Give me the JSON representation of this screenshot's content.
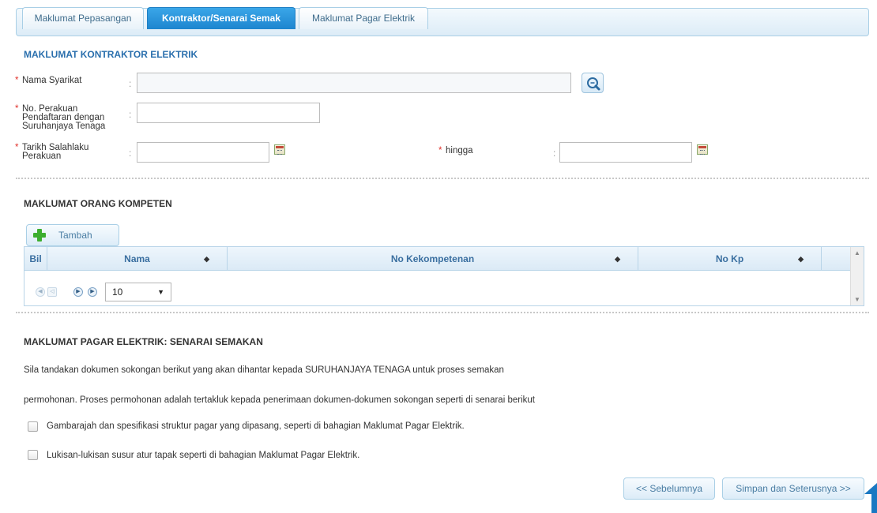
{
  "tabs": [
    {
      "label": "Maklumat Pepasangan",
      "active": false
    },
    {
      "label": "Kontraktor/Senarai Semak",
      "active": true
    },
    {
      "label": "Maklumat Pagar Elektrik",
      "active": false
    }
  ],
  "contractor_section": {
    "title": "MAKLUMAT KONTRAKTOR ELEKTRIK",
    "nama_syarikat_label": "Nama Syarikat",
    "no_perakuan_label_line1": "No. Perakuan",
    "no_perakuan_label_line2": "Pendaftaran dengan",
    "no_perakuan_label_line3": "Suruhanjaya Tenaga",
    "tarikh_label_line1": "Tarikh Salahlaku",
    "tarikh_label_line2": "Perakuan",
    "hingga_label": "hingga",
    "required_mark": "*",
    "colon": ":"
  },
  "competent_section": {
    "title": "MAKLUMAT ORANG KOMPETEN",
    "add_button": "Tambah",
    "columns": [
      "Bil",
      "Nama",
      "No Kekompetenan",
      "No Kp"
    ],
    "sort_glyph": "◆",
    "page_size": "10",
    "page_size_arrow": "▼"
  },
  "checklist_section": {
    "title": "MAKLUMAT PAGAR ELEKTRIK: SENARAI SEMAKAN",
    "paragraph_line1": "Sila tandakan dokumen sokongan berikut yang akan dihantar kepada SURUHANJAYA TENAGA untuk proses semakan",
    "paragraph_line2": "permohonan. Proses permohonan adalah tertakluk kepada penerimaan dokumen-dokumen sokongan seperti di senarai berikut",
    "items": [
      "Gambarajah dan spesifikasi struktur pagar yang dipasang, seperti di bahagian Maklumat Pagar Elektrik.",
      "Lukisan-lukisan susur atur tapak seperti di bahagian Maklumat Pagar Elektrik."
    ]
  },
  "footer": {
    "prev_button": "<< Sebelumnya",
    "next_button": "Simpan dan Seterusnya >>"
  },
  "colors": {
    "active_tab": "#1d85cf",
    "section_title_blue": "#2a6fad",
    "required": "#e0302a",
    "add_icon": "#3cae2f"
  }
}
